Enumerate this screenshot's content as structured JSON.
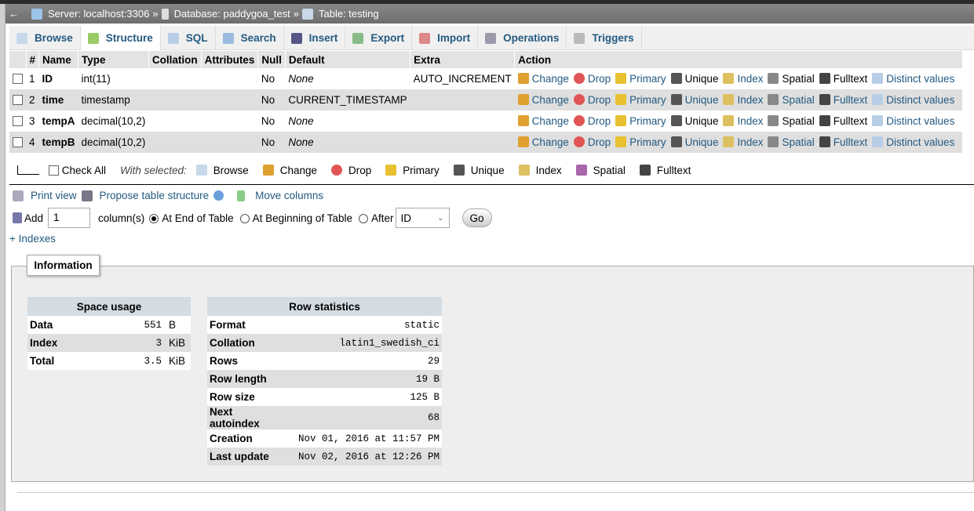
{
  "breadcrumb": {
    "back": "←",
    "server": "Server: localhost:3306",
    "sep": "»",
    "database": "Database: paddygoa_test",
    "table": "Table: testing"
  },
  "tabs": [
    {
      "label": "Browse",
      "icon": "browse-icon"
    },
    {
      "label": "Structure",
      "icon": "structure-icon",
      "active": true
    },
    {
      "label": "SQL",
      "icon": "sql-icon"
    },
    {
      "label": "Search",
      "icon": "search-icon"
    },
    {
      "label": "Insert",
      "icon": "insert-icon"
    },
    {
      "label": "Export",
      "icon": "export-icon"
    },
    {
      "label": "Import",
      "icon": "import-icon"
    },
    {
      "label": "Operations",
      "icon": "wrench-icon"
    },
    {
      "label": "Triggers",
      "icon": "triggers-icon"
    }
  ],
  "columns_header": [
    "#",
    "Name",
    "Type",
    "Collation",
    "Attributes",
    "Null",
    "Default",
    "Extra",
    "Action"
  ],
  "rows": [
    {
      "num": "1",
      "name": "ID",
      "type": "int(11)",
      "collation": "",
      "attributes": "",
      "null": "No",
      "default": "None",
      "default_italic": true,
      "extra": "AUTO_INCREMENT"
    },
    {
      "num": "2",
      "name": "time",
      "type": "timestamp",
      "collation": "",
      "attributes": "",
      "null": "No",
      "default": "CURRENT_TIMESTAMP",
      "default_italic": false,
      "extra": ""
    },
    {
      "num": "3",
      "name": "tempA",
      "type": "decimal(10,2)",
      "collation": "",
      "attributes": "",
      "null": "No",
      "default": "None",
      "default_italic": true,
      "extra": ""
    },
    {
      "num": "4",
      "name": "tempB",
      "type": "decimal(10,2)",
      "collation": "",
      "attributes": "",
      "null": "No",
      "default": "None",
      "default_italic": true,
      "extra": ""
    }
  ],
  "actions": {
    "change": "Change",
    "drop": "Drop",
    "primary": "Primary",
    "unique": "Unique",
    "index": "Index",
    "spatial": "Spatial",
    "fulltext": "Fulltext",
    "distinct": "Distinct values"
  },
  "with_selected": {
    "check_all": "Check All",
    "label": "With selected:",
    "browse": "Browse",
    "change": "Change",
    "drop": "Drop",
    "primary": "Primary",
    "unique": "Unique",
    "index": "Index",
    "spatial": "Spatial",
    "fulltext": "Fulltext"
  },
  "links": {
    "print": "Print view",
    "propose": "Propose table structure",
    "move": "Move columns"
  },
  "add": {
    "label": "Add",
    "count": "1",
    "columns": "column(s)",
    "at_end": "At End of Table",
    "at_beginning": "At Beginning of Table",
    "after": "After",
    "after_value": "ID",
    "go": "Go",
    "selected": "at_end"
  },
  "indexes": "+ Indexes",
  "information": {
    "legend": "Information",
    "space_usage": {
      "title": "Space usage",
      "rows": [
        {
          "k": "Data",
          "v": "551",
          "u": "B"
        },
        {
          "k": "Index",
          "v": "3",
          "u": "KiB"
        },
        {
          "k": "Total",
          "v": "3.5",
          "u": "KiB"
        }
      ]
    },
    "row_statistics": {
      "title": "Row statistics",
      "rows": [
        {
          "k": "Format",
          "v": "static"
        },
        {
          "k": "Collation",
          "v": "latin1_swedish_ci"
        },
        {
          "k": "Rows",
          "v": "29"
        },
        {
          "k": "Row length",
          "v": "19 B"
        },
        {
          "k": "Row size",
          "v": "125 B"
        },
        {
          "k": "Next autoindex",
          "v": "68"
        },
        {
          "k": "Creation",
          "v": "Nov 01, 2016 at 11:57 PM"
        },
        {
          "k": "Last update",
          "v": "Nov 02, 2016 at 12:26 PM"
        }
      ]
    }
  }
}
